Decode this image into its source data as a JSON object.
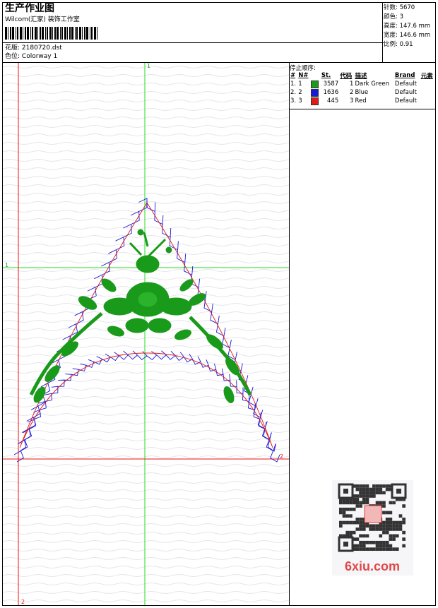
{
  "header": {
    "title": "生产作业图",
    "company": "Wilcom(汇家) 装饰工作室",
    "design_label": "花版:",
    "design_value": "2180720.dst",
    "colorway_label": "色位:",
    "colorway_value": "Colorway 1"
  },
  "stats": {
    "stitches_label": "针数:",
    "stitches_value": "5670",
    "colors_label": "颜色:",
    "colors_value": "3",
    "height_label": "高度:",
    "height_value": "147.6 mm",
    "width_label": "宽度:",
    "width_value": "146.6 mm",
    "scale_label": "比例:",
    "scale_value": "0.91"
  },
  "stop_sequence": {
    "title": "停止顺序:",
    "headers": [
      "#",
      "N#",
      "St.",
      "代码",
      "描述",
      "Brand",
      "元素"
    ],
    "rows": [
      {
        "idx": "1.",
        "n": "1",
        "color": "#1a9a1a",
        "st": "3587",
        "code": "1",
        "desc": "Dark Green",
        "brand": "Default"
      },
      {
        "idx": "2.",
        "n": "2",
        "color": "#1a1ad6",
        "st": "1636",
        "code": "2",
        "desc": "Blue",
        "brand": "Default"
      },
      {
        "idx": "3.",
        "n": "3",
        "color": "#e01b1b",
        "st": "445",
        "code": "3",
        "desc": "Red",
        "brand": "Default"
      }
    ]
  },
  "guides": {
    "marker_1": "1",
    "marker_2": "2"
  },
  "watermark": {
    "text": "6xiu.com"
  },
  "colors": {
    "guide_green": "#22dd22",
    "guide_red": "#ee1111",
    "stitch_green": "#1a9a1a",
    "stitch_blue": "#1a1ad6",
    "stitch_red": "#e01b1b"
  }
}
